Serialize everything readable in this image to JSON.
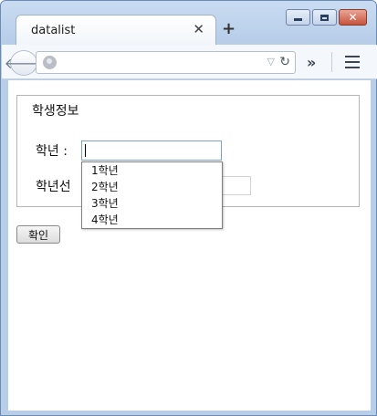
{
  "browser": {
    "tab_title": "datalist",
    "tab_close": "✕",
    "new_tab": "+",
    "minimize": "",
    "close": "✕"
  },
  "form": {
    "legend": "학생정보",
    "grade_label": "학년 :",
    "grade_select_label": "학년선",
    "grade_options": [
      "1학년",
      "2학년",
      "3학년",
      "4학년"
    ],
    "submit_label": "확인"
  }
}
